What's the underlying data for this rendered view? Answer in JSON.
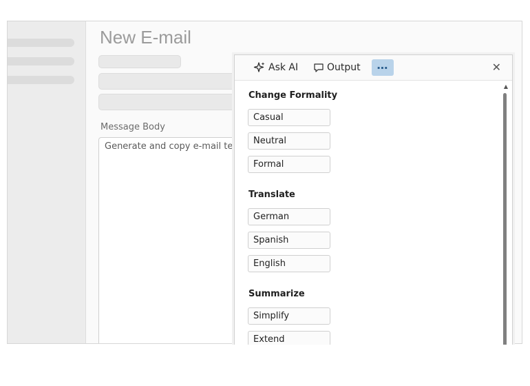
{
  "window": {
    "title": "New E-mail",
    "message_body_label": "Message Body",
    "message_body_value": "Generate and copy e-mail temp"
  },
  "ai_panel": {
    "toolbar": {
      "ask_ai": "Ask AI",
      "output": "Output",
      "more": "⋯",
      "close": "✕"
    },
    "sections": [
      {
        "title": "Change Formality",
        "options": [
          "Casual",
          "Neutral",
          "Formal"
        ]
      },
      {
        "title": "Translate",
        "options": [
          "German",
          "Spanish",
          "English"
        ]
      },
      {
        "title": "Summarize",
        "options": [
          "Simplify",
          "Extend"
        ]
      }
    ]
  },
  "colors": {
    "accent_more": "#b9d3ea",
    "title_gray": "#9b9b9b"
  },
  "icons": {
    "ask_ai": "sparkle-icon",
    "output": "speech-bubble-icon",
    "more": "more-dots-icon",
    "close": "close-icon"
  }
}
